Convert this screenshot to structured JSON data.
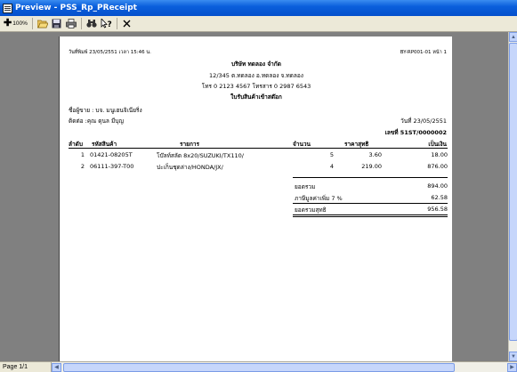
{
  "window": {
    "title": "Preview - PSS_Rp_PReceipt"
  },
  "toolbar": {
    "zoom_label": "100%",
    "buttons": [
      "zoom-in",
      "open",
      "save",
      "print",
      "find",
      "help",
      "close"
    ]
  },
  "status": {
    "page": "Page 1/1"
  },
  "report": {
    "print_info": "วันที่พิมพ์ 23/05/2551  เวลา 15:46 น.",
    "report_code": "BY-RP001-01  หน้า 1",
    "company": "บริษัท ทดลอง จำกัด",
    "address": "12/345 ต.ทดลอง อ.ทดลอง จ.ทดลอง",
    "phone": "โทร 0 2123 4567  โทรสาร 0 2987 6543",
    "doc_title": "ใบรับสินค้าเข้าสต๊อก",
    "seller": "ชื่อผู้ขาย : บจ. มนูเฮนจิเนียริ่ง",
    "contact": "ติดต่อ :คุณ ดุนล มีบุญ",
    "date": "วันที่ 23/05/2551",
    "doc_no": "เลขที่ 51ST/0000002",
    "columns": [
      "ลำดับ",
      "รหัสสินค้า",
      "รายการ",
      "จำนวน",
      "ราคาสุทธิ",
      "เป็นเงิน"
    ],
    "rows": [
      {
        "no": "1",
        "code": "01421-08205T",
        "desc": "โบ๊ลท์สลัด 8x20/SUZUKI/TX110/",
        "qty": "5",
        "price": "3.60",
        "amount": "18.00"
      },
      {
        "no": "2",
        "code": "06111-397-T00",
        "desc": "ปะเก็นชุดล่าง/HONDA/JX/",
        "qty": "4",
        "price": "219.00",
        "amount": "876.00"
      }
    ],
    "totals": {
      "subtotal_label": "ยอดรวม",
      "subtotal": "894.00",
      "vat_label": "ภาษีมูลค่าเพิ่ม  7  %",
      "vat": "62.58",
      "net_label": "ยอดรวมสุทธิ",
      "net": "956.58"
    }
  }
}
